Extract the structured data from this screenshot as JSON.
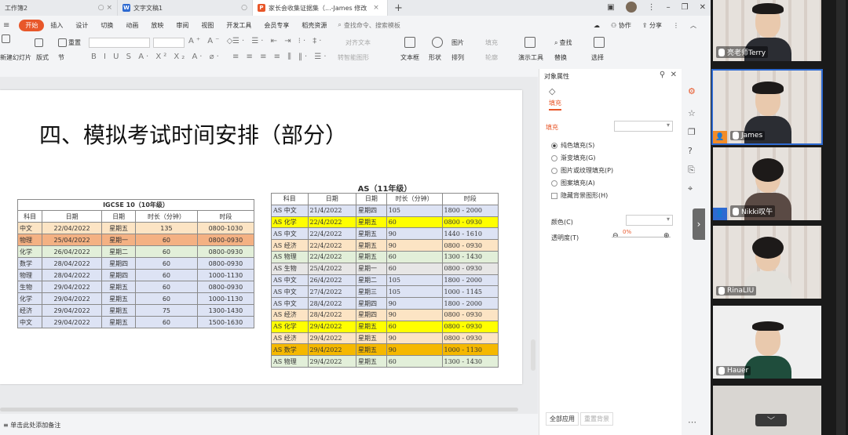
{
  "titlebar": {
    "tabs": [
      {
        "label": "工作簿2",
        "active": false
      },
      {
        "label": "文字文稿1",
        "active": false
      },
      {
        "label": "家长会收集证据集（...-James 修改",
        "active": true
      }
    ],
    "new_tab": "+"
  },
  "menu": {
    "start": "开始",
    "items": [
      "插入",
      "设计",
      "切换",
      "动画",
      "放映",
      "审阅",
      "视图",
      "开发工具",
      "会员专享",
      "稻壳资源"
    ],
    "search_placeholder": "查找命令、搜索模板",
    "collab": "协作",
    "share": "分享"
  },
  "ribbon": {
    "new_slide": "新建幻灯片",
    "layout": "版式",
    "section": "节",
    "reset": "重置",
    "textbox": "文本框",
    "shape": "形状",
    "arrange": "排列",
    "picture": "图片",
    "fill": "填充",
    "outline": "轮廓",
    "align_text": "对齐文本",
    "convert_smartart": "转智能图形",
    "presenter_tools": "演示工具",
    "find": "查找",
    "replace": "替换",
    "select": "选择"
  },
  "slide": {
    "title": "四、模拟考试时间安排（部分）",
    "igcse": {
      "caption": "IGCSE 10（10年级）",
      "headers": [
        "科目",
        "日期",
        "日期",
        "时长（分钟）",
        "时段"
      ],
      "rows": [
        {
          "cells": [
            "中文",
            "22/04/2022",
            "星期五",
            "135",
            "0800-1030"
          ],
          "color": "#fce4c4"
        },
        {
          "cells": [
            "物理",
            "25/04/2022",
            "星期一",
            "60",
            "0800-0930"
          ],
          "color": "#f4b183"
        },
        {
          "cells": [
            "化学",
            "26/04/2022",
            "星期二",
            "60",
            "0800-0930"
          ],
          "color": "#e2efd9"
        },
        {
          "cells": [
            "数学",
            "28/04/2022",
            "星期四",
            "60",
            "0800-0930"
          ],
          "color": "#dde3f4"
        },
        {
          "cells": [
            "物理",
            "28/04/2022",
            "星期四",
            "60",
            "1000-1130"
          ],
          "color": "#dde3f4"
        },
        {
          "cells": [
            "生物",
            "29/04/2022",
            "星期五",
            "60",
            "0800-0930"
          ],
          "color": "#dde3f4"
        },
        {
          "cells": [
            "化学",
            "29/04/2022",
            "星期五",
            "60",
            "1000-1130"
          ],
          "color": "#dde3f4"
        },
        {
          "cells": [
            "经济",
            "29/04/2022",
            "星期五",
            "75",
            "1300-1430"
          ],
          "color": "#dde3f4"
        },
        {
          "cells": [
            "中文",
            "29/04/2022",
            "星期五",
            "60",
            "1500-1630"
          ],
          "color": "#dde3f4"
        }
      ]
    },
    "as": {
      "caption": "AS（11年级）",
      "headers": [
        "科目",
        "日期",
        "日期",
        "时长（分钟）",
        "时段"
      ],
      "rows": [
        {
          "cells": [
            "AS 中文",
            "21/4/2022",
            "星期四",
            "105",
            "1800 - 2000"
          ],
          "color": "#dde3f4"
        },
        {
          "cells": [
            "AS 化学",
            "22/4/2022",
            "星期五",
            "60",
            "0800 - 0930"
          ],
          "color": "#ffff00"
        },
        {
          "cells": [
            "AS 中文",
            "22/4/2022",
            "星期五",
            "90",
            "1440 - 1610"
          ],
          "color": "#dde3f4"
        },
        {
          "cells": [
            "AS 经济",
            "22/4/2022",
            "星期五",
            "90",
            "0800 - 0930"
          ],
          "color": "#fce4c4"
        },
        {
          "cells": [
            "AS 物理",
            "22/4/2022",
            "星期五",
            "60",
            "1300 - 1430"
          ],
          "color": "#e2efd9"
        },
        {
          "cells": [
            "AS 生物",
            "25/4/2022",
            "星期一",
            "60",
            "0800 - 0930"
          ],
          "color": "#e7e6e6"
        },
        {
          "cells": [
            "AS 中文",
            "26/4/2022",
            "星期二",
            "105",
            "1800 - 2000"
          ],
          "color": "#dde3f4"
        },
        {
          "cells": [
            "AS 中文",
            "27/4/2022",
            "星期三",
            "105",
            "1000 - 1145"
          ],
          "color": "#dde3f4"
        },
        {
          "cells": [
            "AS 中文",
            "28/4/2022",
            "星期四",
            "90",
            "1800 - 2000"
          ],
          "color": "#dde3f4"
        },
        {
          "cells": [
            "AS 经济",
            "28/4/2022",
            "星期四",
            "90",
            "0800 - 0930"
          ],
          "color": "#fce4c4"
        },
        {
          "cells": [
            "AS 化学",
            "29/4/2022",
            "星期五",
            "60",
            "0800 - 0930"
          ],
          "color": "#ffff00"
        },
        {
          "cells": [
            "AS 经济",
            "29/4/2022",
            "星期五",
            "90",
            "0800 - 0930"
          ],
          "color": "#fce4c4"
        },
        {
          "cells": [
            "AS 数学",
            "29/4/2022",
            "星期五",
            "90",
            "1000 - 1130"
          ],
          "color": "#f5b800"
        },
        {
          "cells": [
            "AS 物理",
            "29/4/2022",
            "星期五",
            "60",
            "1300 - 1430"
          ],
          "color": "#e2efd9"
        }
      ]
    }
  },
  "status": {
    "notes": "单击此处添加备注"
  },
  "panel": {
    "title": "对象属性",
    "tab_fill": "填充",
    "fill_header": "填充",
    "options": [
      "纯色填充(S)",
      "渐变填充(G)",
      "图片或纹理填充(P)",
      "图案填充(A)"
    ],
    "hide_bg": "隐藏背景图形(H)",
    "color_label": "颜色(C)",
    "transparency_label": "透明度(T)",
    "transparency_value": "0%",
    "apply_all": "全部应用",
    "reset_bg": "重置背景"
  },
  "videos": [
    {
      "name": "亮老师Terry"
    },
    {
      "name": "James"
    },
    {
      "name": "Nikki叹午"
    },
    {
      "name": "RinaLIU"
    },
    {
      "name": "Hauer"
    }
  ]
}
